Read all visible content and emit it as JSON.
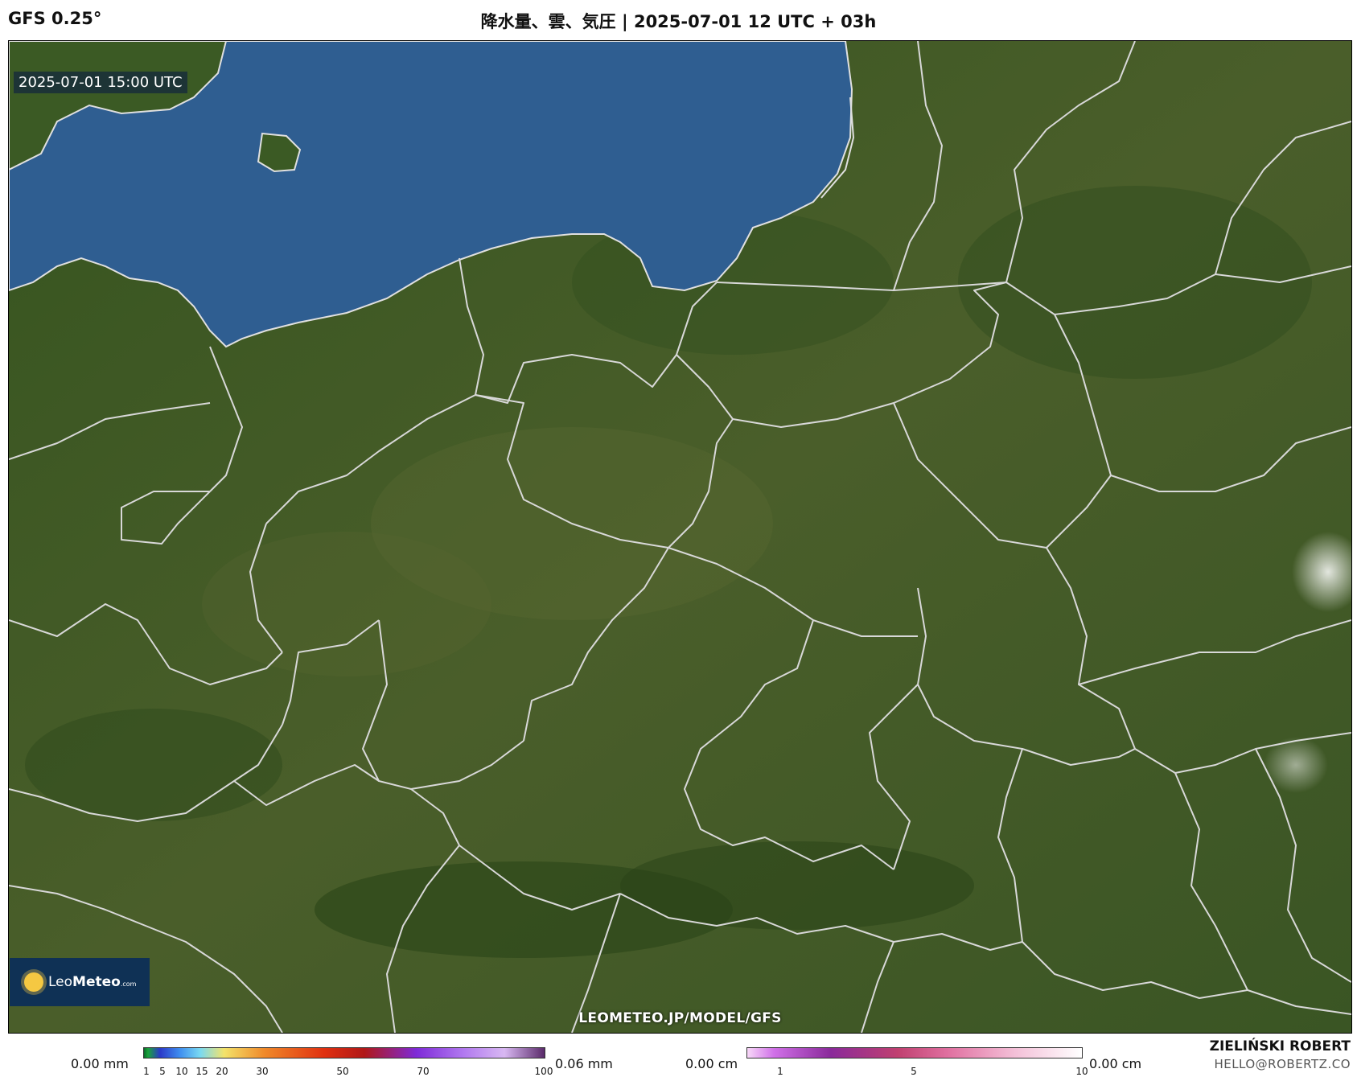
{
  "header": {
    "model": "GFS 0.25°",
    "title": "降水量、雲、気圧 | 2025-07-01 12 UTC + 03h"
  },
  "map": {
    "valid_time": "2025-07-01 15:00 UTC",
    "logo": {
      "prefix": "Leo",
      "brand": "Meteo",
      "suffix": ".com"
    },
    "source_url": "LEOMETEO.JP/MODEL/GFS",
    "colors": {
      "sea": "#2f5e91",
      "land": "#3e5a26",
      "borders": "#d8d8d8"
    }
  },
  "legend": {
    "precip": {
      "min_label": "0.00 mm",
      "max_label": "0.06 mm",
      "ticks": [
        "1",
        "5",
        "10",
        "15",
        "20",
        "30",
        "50",
        "70",
        "100"
      ]
    },
    "snow": {
      "min_label": "0.00 cm",
      "max_label": "0.00 cm",
      "ticks": [
        "1",
        "5",
        "10"
      ]
    }
  },
  "author": {
    "name": "ZIELIŃSKI ROBERT",
    "email": "HELLO@ROBERTZ.CO"
  }
}
